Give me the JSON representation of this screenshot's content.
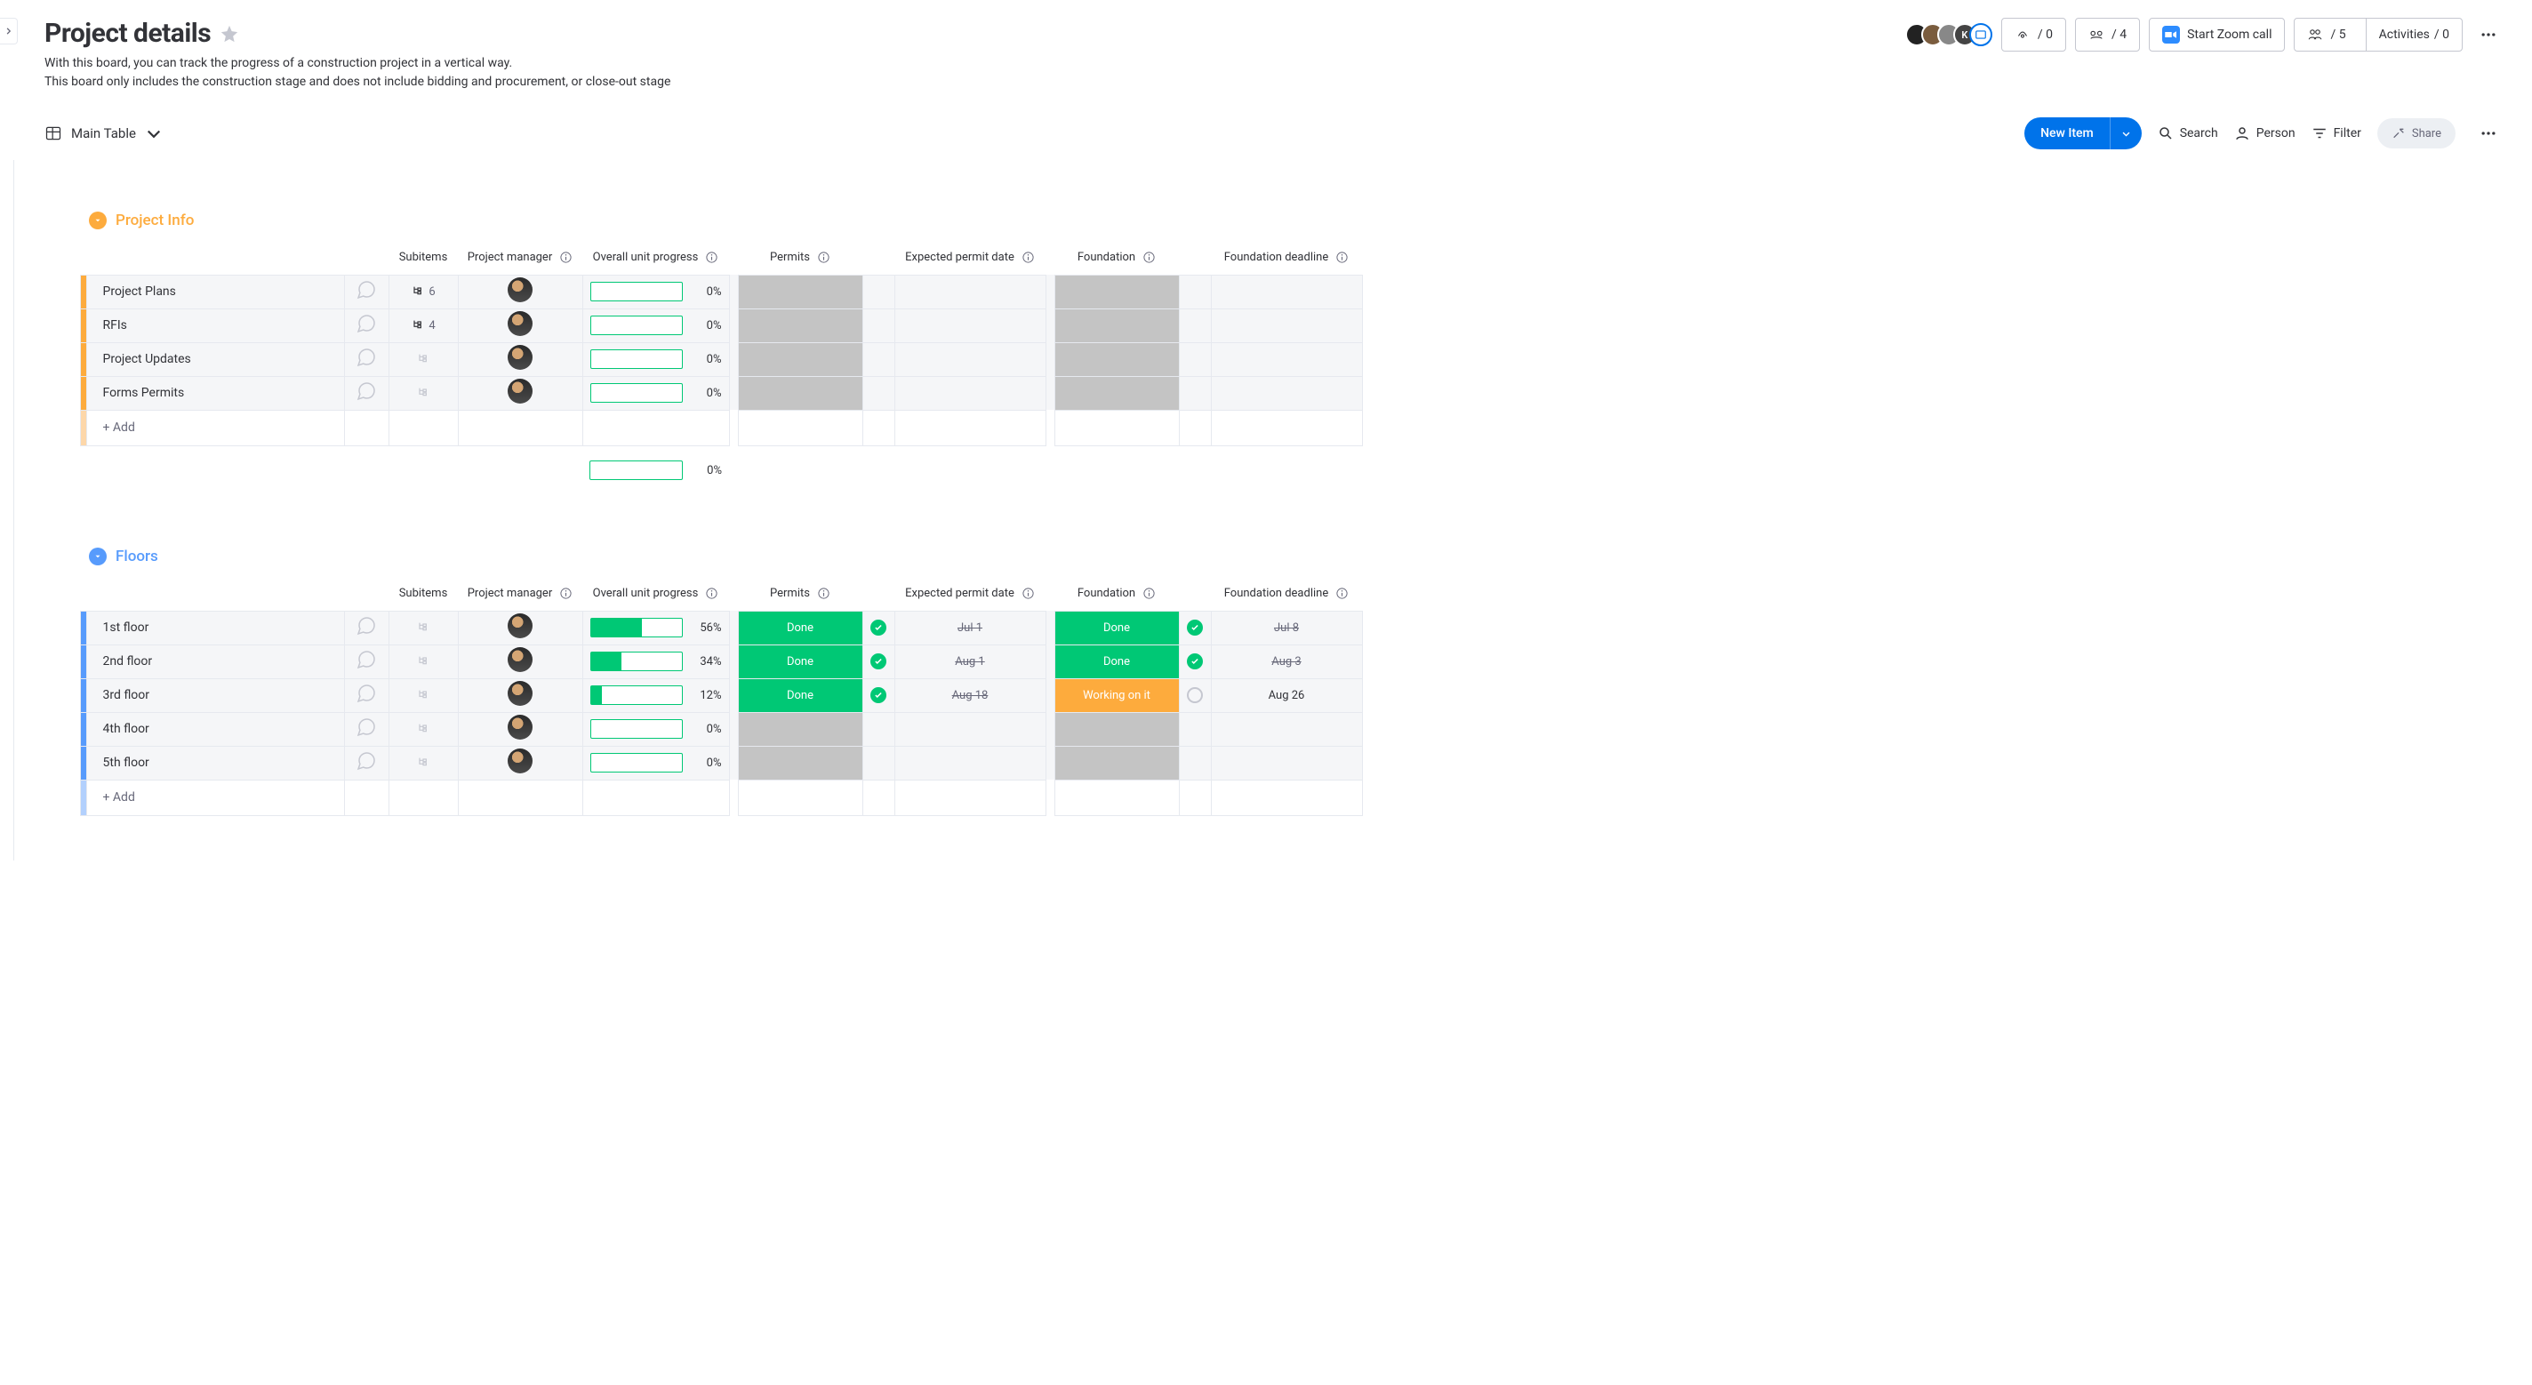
{
  "header": {
    "title": "Project details",
    "subtitle_line1": "With this board, you can track the progress of a construction project in a vertical way.",
    "subtitle_line2": "This board only includes the construction stage and does not include bidding and procurement, or close-out stage",
    "integrations": {
      "icon_a_count": "/ 0",
      "icon_b_count": "/ 4"
    },
    "zoom_label": "Start Zoom call",
    "members": "/ 5",
    "activities_label": "Activities",
    "activities_count": "/ 0"
  },
  "toolbar": {
    "view_label": "Main Table",
    "new_item": "New Item",
    "search": "Search",
    "person": "Person",
    "filter": "Filter",
    "share": "Share"
  },
  "columns": {
    "subitems": "Subitems",
    "pm": "Project manager",
    "progress": "Overall unit progress",
    "permits": "Permits",
    "permit_date": "Expected permit date",
    "foundation": "Foundation",
    "foundation_deadline": "Foundation deadline"
  },
  "status_labels": {
    "done": "Done",
    "working": "Working on it"
  },
  "add_row": "+ Add",
  "groups": [
    {
      "id": "project_info",
      "name": "Project Info",
      "color": "orange",
      "rows": [
        {
          "name": "Project Plans",
          "subitems": "6",
          "progress": 0
        },
        {
          "name": "RFIs",
          "subitems": "4",
          "progress": 0
        },
        {
          "name": "Project Updates",
          "subitems": "",
          "progress": 0
        },
        {
          "name": "Forms Permits",
          "subitems": "",
          "progress": 0
        }
      ],
      "summary_progress": 0
    },
    {
      "id": "floors",
      "name": "Floors",
      "color": "blue",
      "rows": [
        {
          "name": "1st floor",
          "progress": 56,
          "permits": "done",
          "permit_date": "Jul 1",
          "permit_done": true,
          "foundation": "done",
          "foundation_deadline": "Jul 8",
          "foundation_done": true
        },
        {
          "name": "2nd floor",
          "progress": 34,
          "permits": "done",
          "permit_date": "Aug 1",
          "permit_done": true,
          "foundation": "done",
          "foundation_deadline": "Aug 3",
          "foundation_done": true
        },
        {
          "name": "3rd floor",
          "progress": 12,
          "permits": "done",
          "permit_date": "Aug 18",
          "permit_done": true,
          "foundation": "working",
          "foundation_deadline": "Aug 26",
          "foundation_done": false
        },
        {
          "name": "4th floor",
          "progress": 0
        },
        {
          "name": "5th floor",
          "progress": 0
        }
      ]
    }
  ]
}
